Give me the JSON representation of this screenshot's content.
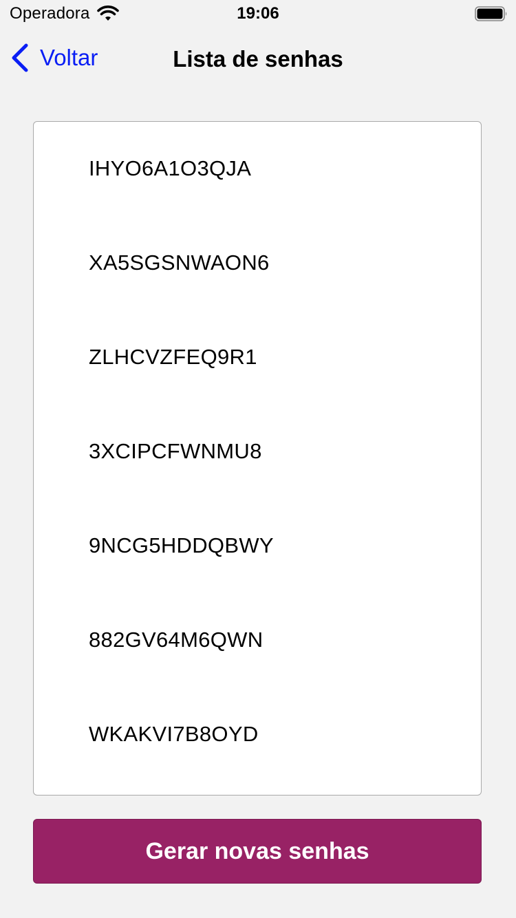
{
  "status_bar": {
    "carrier": "Operadora",
    "time": "19:06",
    "wifi_icon": "wifi-icon",
    "battery_icon": "battery-icon"
  },
  "nav": {
    "back_label": "Voltar",
    "back_icon": "chevron-left-icon",
    "title": "Lista de senhas"
  },
  "passwords": [
    "IHYO6A1O3QJA",
    "XA5SGSNWAON6",
    "ZLHCVZFEQ9R1",
    "3XCIPCFWNMU8",
    "9NCG5HDDQBWY",
    "882GV64M6QWN",
    "WKAKVI7B8OYD"
  ],
  "actions": {
    "generate_label": "Gerar novas senhas"
  },
  "colors": {
    "background": "#f2f2f2",
    "accent_link": "#0a1ef5",
    "button_bg": "#982265",
    "button_text": "#ffffff",
    "list_border": "#a9a9a9"
  }
}
